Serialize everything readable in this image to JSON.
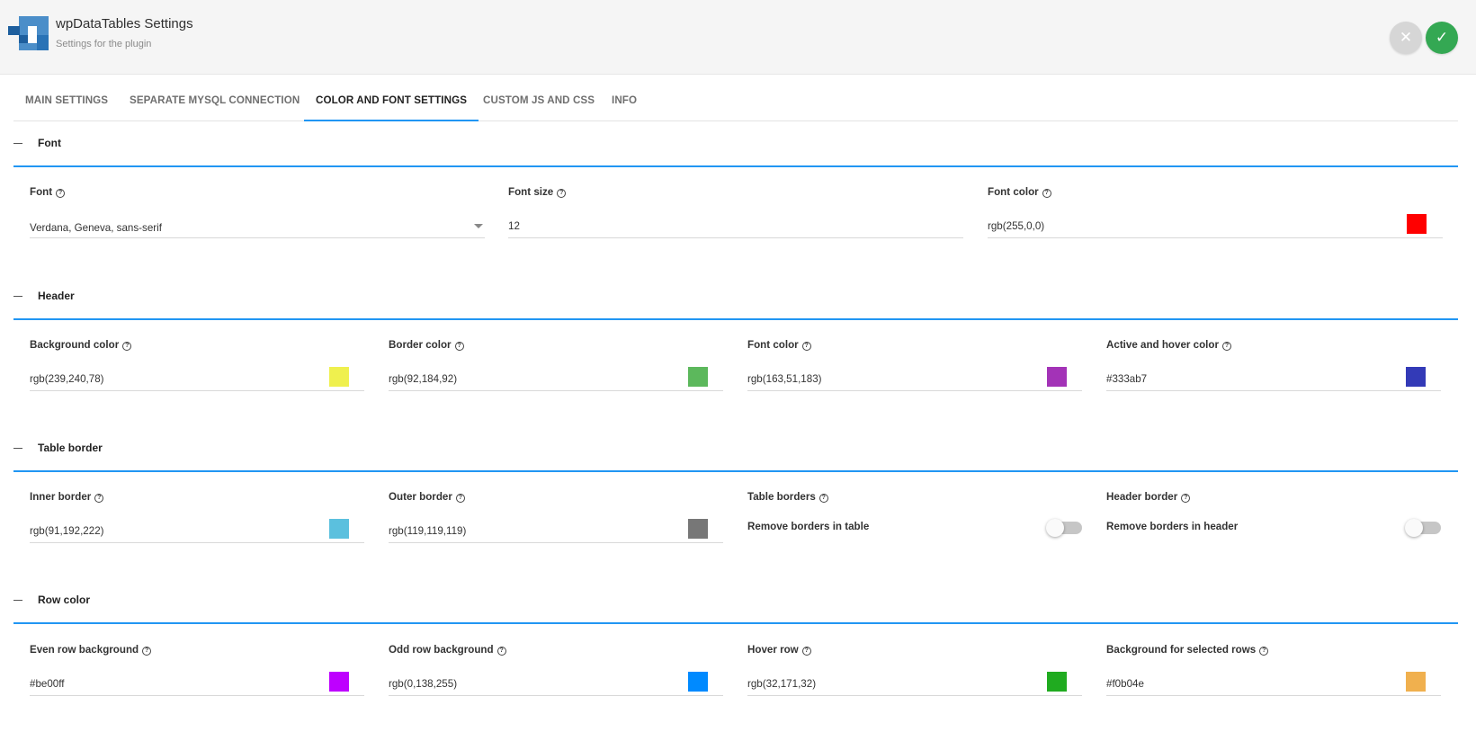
{
  "header": {
    "title": "wpDataTables Settings",
    "subtitle": "Settings for the plugin",
    "close_icon": "close-icon",
    "save_icon": "check-icon",
    "save_color": "#34a853"
  },
  "tabs": [
    {
      "label": "MAIN SETTINGS",
      "active": false
    },
    {
      "label": "SEPARATE MYSQL CONNECTION",
      "active": false
    },
    {
      "label": "COLOR AND FONT SETTINGS",
      "active": true
    },
    {
      "label": "CUSTOM JS AND CSS",
      "active": false
    },
    {
      "label": "INFO",
      "active": false
    }
  ],
  "accent_color": "#2196f3",
  "font_section": {
    "title": "Font",
    "font": {
      "label": "Font",
      "value": "Verdana, Geneva, sans-serif"
    },
    "font_size": {
      "label": "Font size",
      "value": "12"
    },
    "font_color": {
      "label": "Font color",
      "value": "rgb(255,0,0)",
      "swatch": "#ff0000"
    }
  },
  "header_section": {
    "title": "Header",
    "fields": [
      {
        "label": "Background color",
        "value": "rgb(239,240,78)",
        "swatch": "#eff04e"
      },
      {
        "label": "Border color",
        "value": "rgb(92,184,92)",
        "swatch": "#5cb85c"
      },
      {
        "label": "Font color",
        "value": "rgb(163,51,183)",
        "swatch": "#a333b7"
      },
      {
        "label": "Active and hover color",
        "value": "#333ab7",
        "swatch": "#333ab7"
      }
    ]
  },
  "border_section": {
    "title": "Table border",
    "inner": {
      "label": "Inner border",
      "value": "rgb(91,192,222)",
      "swatch": "#5bc0de"
    },
    "outer": {
      "label": "Outer border",
      "value": "rgb(119,119,119)",
      "swatch": "#777777"
    },
    "table_borders": {
      "label": "Table borders",
      "toggle_label": "Remove borders in table",
      "on": false
    },
    "header_border": {
      "label": "Header border",
      "toggle_label": "Remove borders in header",
      "on": false
    }
  },
  "row_section": {
    "title": "Row color",
    "fields": [
      {
        "label": "Even row background",
        "value": "#be00ff",
        "swatch": "#be00ff"
      },
      {
        "label": "Odd row background",
        "value": "rgb(0,138,255)",
        "swatch": "#008aff"
      },
      {
        "label": "Hover row",
        "value": "rgb(32,171,32)",
        "swatch": "#20ab20"
      },
      {
        "label": "Background for selected rows",
        "value": "#f0b04e",
        "swatch": "#f0b04e"
      }
    ]
  }
}
